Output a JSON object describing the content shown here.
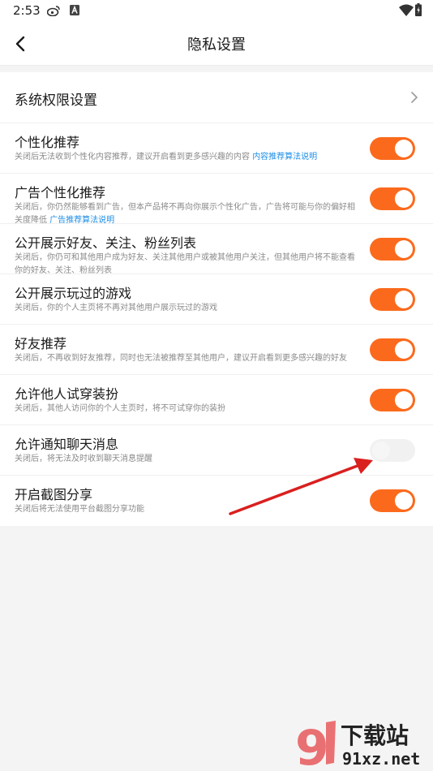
{
  "status_bar": {
    "time": "2:53",
    "icons": [
      "weibo-icon",
      "a-badge-icon",
      "wifi-icon",
      "battery-icon"
    ]
  },
  "header": {
    "title": "隐私设置",
    "back_icon": "chevron-left-icon"
  },
  "settings": {
    "system_permissions": {
      "title": "系统权限设置",
      "icon": "chevron-right-icon"
    },
    "items": [
      {
        "title": "个性化推荐",
        "desc": "关闭后无法收到个性化内容推荐，建议开启看到更多感兴趣的内容 ",
        "link": "内容推荐算法说明",
        "enabled": true
      },
      {
        "title": "广告个性化推荐",
        "desc": "关闭后，你仍然能够看到广告，但本产品将不再向你展示个性化广告，广告将可能与你的偏好相关度降低 ",
        "link": "广告推荐算法说明",
        "enabled": true
      },
      {
        "title": "公开展示好友、关注、粉丝列表",
        "desc": "关闭后，你仍可和其他用户成为好友、关注其他用户或被其他用户关注，但其他用户将不能查看你的好友、关注、粉丝列表",
        "link": "",
        "enabled": true
      },
      {
        "title": "公开展示玩过的游戏",
        "desc": "关闭后，你的个人主页将不再对其他用户展示玩过的游戏",
        "link": "",
        "enabled": true
      },
      {
        "title": "好友推荐",
        "desc": "关闭后，不再收到好友推荐，同时也无法被推荐至其他用户，建议开启看到更多感兴趣的好友",
        "link": "",
        "enabled": true
      },
      {
        "title": "允许他人试穿装扮",
        "desc": "关闭后，其他人访问你的个人主页时，将不可试穿你的装扮",
        "link": "",
        "enabled": true
      },
      {
        "title": "允许通知聊天消息",
        "desc": "关闭后，将无法及时收到聊天消息提醒",
        "link": "",
        "enabled": false
      },
      {
        "title": "开启截图分享",
        "desc": "关闭后将无法使用平台截图分享功能",
        "link": "",
        "enabled": true
      }
    ]
  },
  "colors": {
    "toggle_on": "#fb6a1c",
    "toggle_off": "#f1f1f1",
    "link": "#1e8fe8",
    "annotation_arrow": "#d9201f"
  },
  "watermark": {
    "site": "91xz.net",
    "brand": "下载站"
  }
}
